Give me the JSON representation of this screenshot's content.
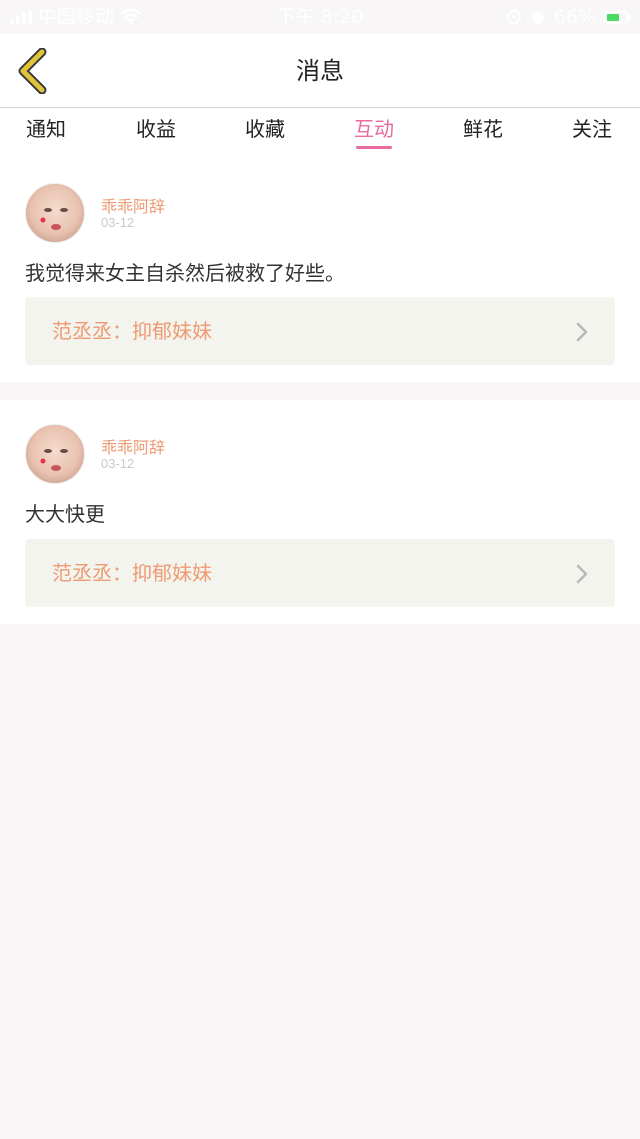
{
  "status_bar": {
    "carrier": "中国移动",
    "time": "下午 8:20",
    "battery": "66%"
  },
  "nav": {
    "title": "消息"
  },
  "tabs": [
    {
      "label": "通知",
      "active": false
    },
    {
      "label": "收益",
      "active": false
    },
    {
      "label": "收藏",
      "active": false
    },
    {
      "label": "互动",
      "active": true
    },
    {
      "label": "鲜花",
      "active": false
    },
    {
      "label": "关注",
      "active": false
    }
  ],
  "interactions": [
    {
      "user": "乖乖阿辞",
      "date": "03-12",
      "comment": "我觉得来女主自杀然后被救了好些。",
      "reference": "范丞丞：抑郁妹妹"
    },
    {
      "user": "乖乖阿辞",
      "date": "03-12",
      "comment": "大大快更",
      "reference": "范丞丞：抑郁妹妹"
    }
  ],
  "colors": {
    "accent": "#e86c9f",
    "name_color": "#ee9a73",
    "back_icon": "#e0c43a",
    "background": "#f8f6f6"
  },
  "icons": {
    "back": "chevron-left-icon",
    "row_arrow": "chevron-right-icon"
  }
}
